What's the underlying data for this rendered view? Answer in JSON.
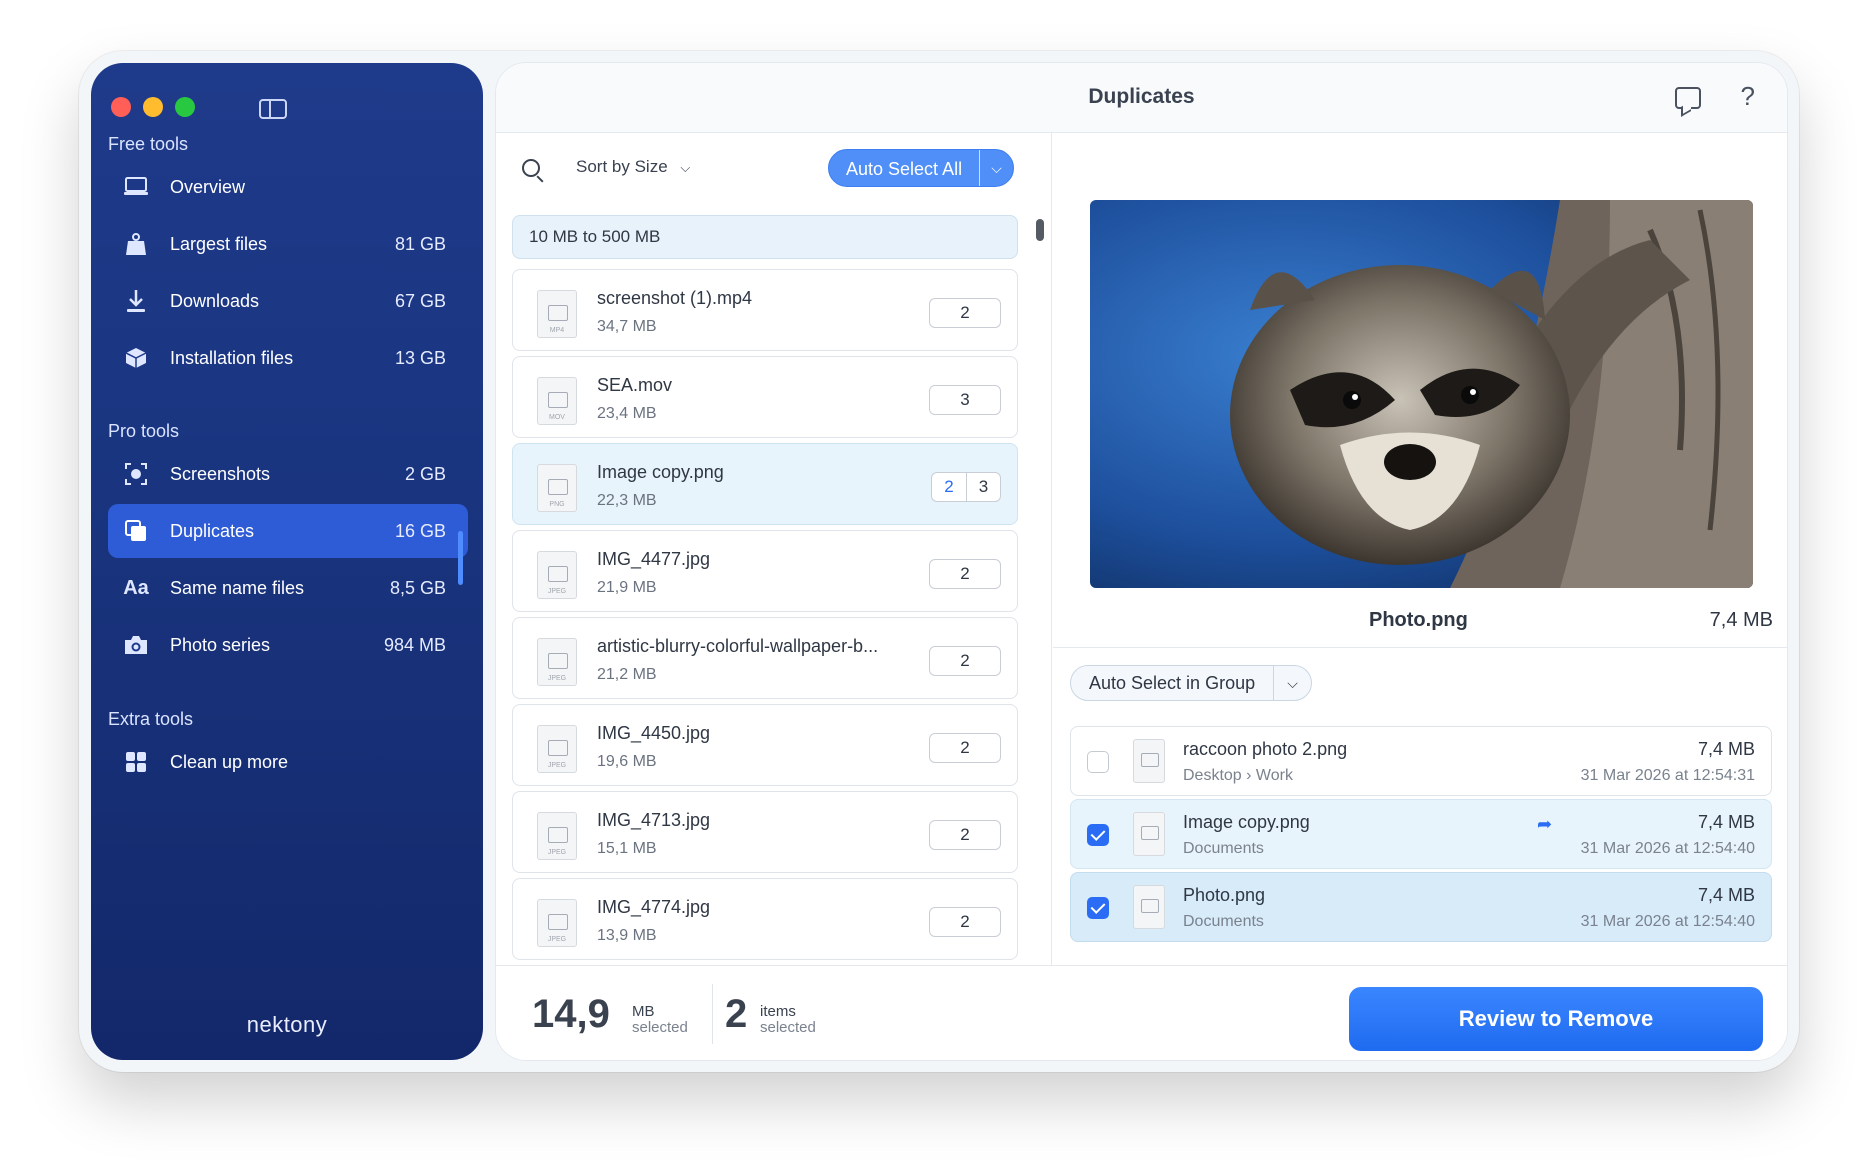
{
  "sidebar": {
    "sections": {
      "free": "Free tools",
      "pro": "Pro tools",
      "extra": "Extra tools"
    },
    "items": [
      {
        "label": "Overview",
        "size": "",
        "icon": "laptop-icon"
      },
      {
        "label": "Largest files",
        "size": "81 GB",
        "icon": "weight-icon"
      },
      {
        "label": "Downloads",
        "size": "67 GB",
        "icon": "download-icon"
      },
      {
        "label": "Installation files",
        "size": "13 GB",
        "icon": "package-icon"
      },
      {
        "label": "Screenshots",
        "size": "2 GB",
        "icon": "screenshot-icon"
      },
      {
        "label": "Duplicates",
        "size": "16 GB",
        "icon": "duplicates-icon"
      },
      {
        "label": "Same name files",
        "size": "8,5 GB",
        "icon": "text-aa-icon"
      },
      {
        "label": "Photo series",
        "size": "984 MB",
        "icon": "camera-icon"
      },
      {
        "label": "Clean up more",
        "size": "",
        "icon": "grid-icon"
      }
    ],
    "logo": "nektony"
  },
  "header": {
    "title": "Duplicates"
  },
  "list": {
    "sort_label": "Sort by Size",
    "auto_select_all": "Auto Select All",
    "group_header": "10 MB to 500 MB",
    "files": [
      {
        "name": "screenshot (1).mp4",
        "size": "34,7 MB",
        "ext": "MP4",
        "count": "2"
      },
      {
        "name": "SEA.mov",
        "size": "23,4 MB",
        "ext": "MOV",
        "count": "3"
      },
      {
        "name": "Image copy.png",
        "size": "22,3 MB",
        "ext": "PNG",
        "count_selected": "2",
        "count": "3"
      },
      {
        "name": "IMG_4477.jpg",
        "size": "21,9 MB",
        "ext": "JPEG",
        "count": "2"
      },
      {
        "name": "artistic-blurry-colorful-wallpaper-b...",
        "size": "21,2 MB",
        "ext": "JPEG",
        "count": "2"
      },
      {
        "name": "IMG_4450.jpg",
        "size": "19,6 MB",
        "ext": "JPEG",
        "count": "2"
      },
      {
        "name": "IMG_4713.jpg",
        "size": "15,1 MB",
        "ext": "JPEG",
        "count": "2"
      },
      {
        "name": "IMG_4774.jpg",
        "size": "13,9 MB",
        "ext": "JPEG",
        "count": "2"
      }
    ]
  },
  "preview": {
    "name": "Photo.png",
    "size": "7,4 MB",
    "auto_select_group": "Auto Select in Group",
    "duplicates": [
      {
        "name": "raccoon photo 2.png",
        "path": "Desktop › Work",
        "size": "7,4 MB",
        "date": "31 Mar 2026 at 12:54:31",
        "checked": false
      },
      {
        "name": "Image copy.png",
        "path": "Documents",
        "size": "7,4 MB",
        "date": "31 Mar 2026 at 12:54:40",
        "checked": true
      },
      {
        "name": "Photo.png",
        "path": "Documents",
        "size": "7,4 MB",
        "date": "31 Mar 2026 at 12:54:40",
        "checked": true
      }
    ]
  },
  "footer": {
    "size_value": "14,9",
    "size_unit": "MB",
    "size_sub": "selected",
    "items_value": "2",
    "items_unit": "items",
    "items_sub": "selected",
    "review_button": "Review to Remove"
  },
  "colors": {
    "sidebar": "#1e3a8a",
    "accent": "#2a6df4",
    "active_item": "#2e5bd6"
  }
}
